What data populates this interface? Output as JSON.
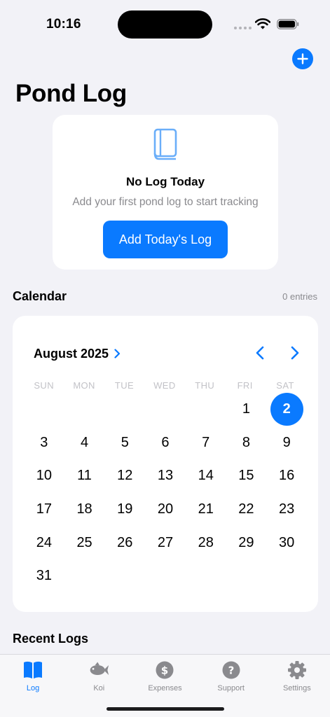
{
  "status_bar": {
    "time": "10:16"
  },
  "header": {
    "title": "Pond Log",
    "add_icon": "plus-icon"
  },
  "empty_state": {
    "icon": "book-icon",
    "title": "No Log Today",
    "subtitle": "Add your first pond log to start tracking",
    "button_label": "Add Today's Log"
  },
  "calendar": {
    "section_title": "Calendar",
    "entries": "0 entries",
    "month": "August 2025",
    "weekdays": [
      "SUN",
      "MON",
      "TUE",
      "WED",
      "THU",
      "FRI",
      "SAT"
    ],
    "days": [
      "",
      "",
      "",
      "",
      "",
      "1",
      "2",
      "3",
      "4",
      "5",
      "6",
      "7",
      "8",
      "9",
      "10",
      "11",
      "12",
      "13",
      "14",
      "15",
      "16",
      "17",
      "18",
      "19",
      "20",
      "21",
      "22",
      "23",
      "24",
      "25",
      "26",
      "27",
      "28",
      "29",
      "30",
      "31"
    ],
    "selected_day": "2"
  },
  "recent": {
    "section_title": "Recent Logs"
  },
  "tabs": [
    {
      "label": "Log",
      "icon": "book-icon",
      "active": true
    },
    {
      "label": "Koi",
      "icon": "fish-icon",
      "active": false
    },
    {
      "label": "Expenses",
      "icon": "dollar-icon",
      "active": false
    },
    {
      "label": "Support",
      "icon": "question-icon",
      "active": false
    },
    {
      "label": "Settings",
      "icon": "gear-icon",
      "active": false
    }
  ],
  "colors": {
    "accent": "#0a7aff",
    "background": "#f2f2f7",
    "muted": "#8a8a8e"
  }
}
